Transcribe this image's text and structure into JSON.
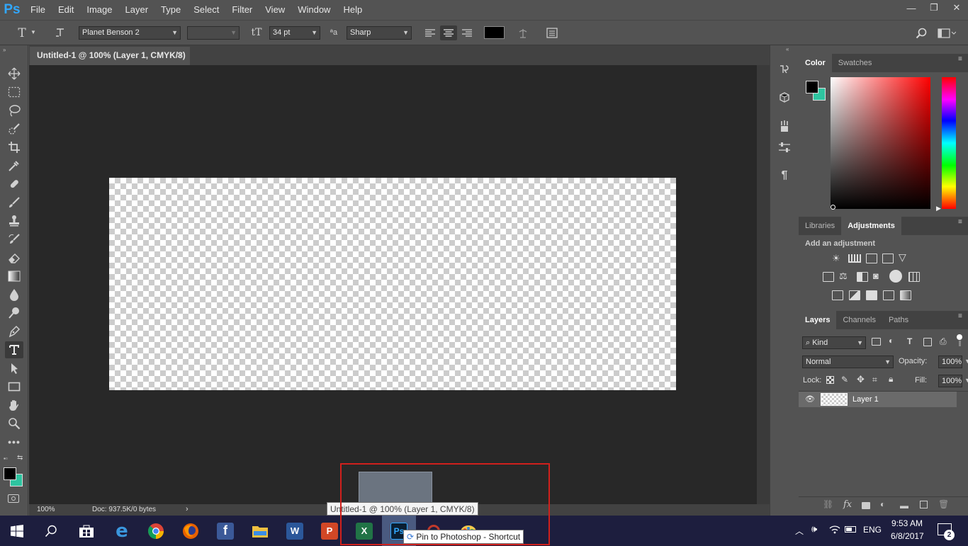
{
  "app": {
    "logo": "Ps"
  },
  "menu": [
    "File",
    "Edit",
    "Image",
    "Layer",
    "Type",
    "Select",
    "Filter",
    "View",
    "Window",
    "Help"
  ],
  "window_controls": {
    "minimize": "—",
    "restore": "❐",
    "close": "✕"
  },
  "options": {
    "tool_glyph": "T",
    "font_family": "Planet Benson 2",
    "font_style": "",
    "font_size": "34 pt",
    "anti_alias": "Sharp",
    "text_color": "#000000"
  },
  "document": {
    "tab_title": "Untitled-1 @ 100% (Layer 1, CMYK/8)",
    "zoom": "100%",
    "doc_info": "Doc: 937.5K/0 bytes"
  },
  "tools": [
    "move-tool",
    "marquee-tool",
    "lasso-tool",
    "quick-select-tool",
    "crop-tool",
    "eyedropper-tool",
    "healing-brush-tool",
    "brush-tool",
    "clone-stamp-tool",
    "history-brush-tool",
    "eraser-tool",
    "gradient-tool",
    "blur-tool",
    "dodge-tool",
    "pen-tool",
    "type-tool",
    "path-select-tool",
    "rectangle-tool",
    "hand-tool",
    "zoom-tool",
    "more-tools"
  ],
  "colors": {
    "foreground": "#000000",
    "background": "#2ec4a0",
    "accent": "#31a8ff"
  },
  "color_panel": {
    "tabs": [
      "Color",
      "Swatches"
    ]
  },
  "adjustments_panel": {
    "tabs": [
      "Libraries",
      "Adjustments"
    ],
    "heading": "Add an adjustment"
  },
  "layers_panel": {
    "tabs": [
      "Layers",
      "Channels",
      "Paths"
    ],
    "filter": "Kind",
    "blend_mode": "Normal",
    "opacity_label": "Opacity:",
    "opacity": "100%",
    "lock_label": "Lock:",
    "fill_label": "Fill:",
    "fill": "100%",
    "layers": [
      {
        "name": "Layer 1",
        "visible": true
      }
    ]
  },
  "taskbar": {
    "apps": [
      "start",
      "search",
      "store",
      "edge",
      "chrome",
      "firefox",
      "facebook",
      "file-explorer",
      "word",
      "powerpoint",
      "excel",
      "photoshop",
      "other",
      "paint"
    ],
    "language": "ENG",
    "time": "9:53 AM",
    "date": "6/8/2017",
    "notifications": "2"
  },
  "tooltips": {
    "window_preview": "Untitled-1 @ 100% (Layer 1, CMYK/8)",
    "jumplist": "Pin to Photoshop - Shortcut"
  }
}
